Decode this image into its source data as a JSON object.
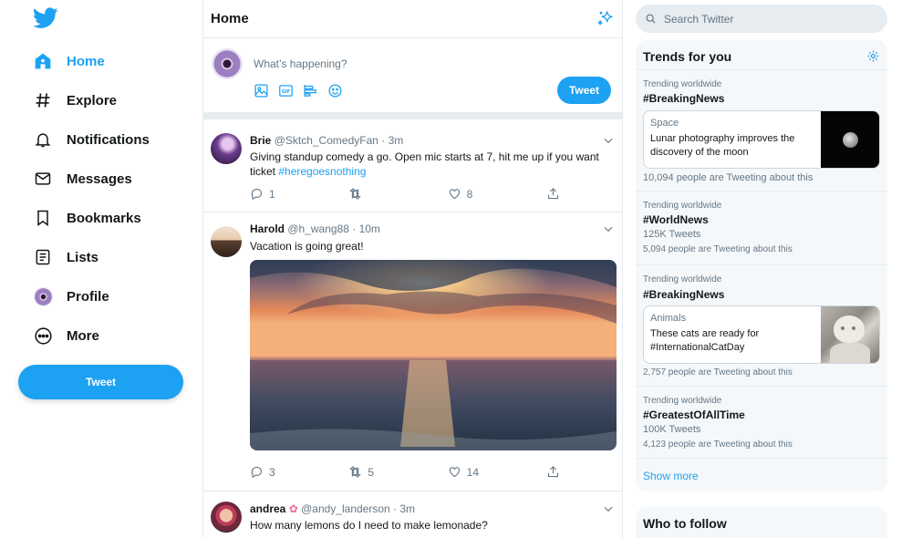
{
  "nav": {
    "items": [
      {
        "label": "Home",
        "icon": "home-icon"
      },
      {
        "label": "Explore",
        "icon": "hashtag-icon"
      },
      {
        "label": "Notifications",
        "icon": "bell-icon"
      },
      {
        "label": "Messages",
        "icon": "mail-icon"
      },
      {
        "label": "Bookmarks",
        "icon": "bookmark-icon"
      },
      {
        "label": "Lists",
        "icon": "list-icon"
      },
      {
        "label": "Profile",
        "icon": "profile-avatar-icon"
      },
      {
        "label": "More",
        "icon": "more-icon"
      }
    ],
    "tweet_button": "Tweet"
  },
  "colors": {
    "accent": "#1da1f2",
    "text": "#14171a",
    "muted": "#657786",
    "border": "#e6ecf0"
  },
  "center": {
    "title": "Home",
    "composer": {
      "placeholder": "What’s happening?",
      "tweet_button": "Tweet"
    },
    "tweets": [
      {
        "name": "Brie",
        "handle": "@Sktch_ComedyFan · 3m",
        "text": "Giving standup comedy a go. Open mic starts at 7, hit me up if you want ticket ",
        "hashtag": "#heregoesnothing",
        "replies": "1",
        "retweets": "",
        "likes": "8"
      },
      {
        "name": "Harold",
        "handle": "@h_wang88 · 10m",
        "text": "Vacation is going great!",
        "replies": "3",
        "retweets": "5",
        "likes": "14"
      },
      {
        "name": "andrea",
        "handle": "@andy_landerson · 3m",
        "text": "How many lemons do I need to make lemonade?"
      }
    ]
  },
  "right": {
    "search_placeholder": "Search Twitter",
    "trends_title": "Trends for you",
    "trends": [
      {
        "meta": "Trending worldwide",
        "tag": "#BreakingNews",
        "card": {
          "category": "Space",
          "text": "Lunar photography improves the discovery of the moon"
        },
        "count": "10,094 people are Tweeting about this"
      },
      {
        "meta": "Trending worldwide",
        "tag": "#WorldNews",
        "tweets": "125K Tweets",
        "count": "5,094 people are Tweeting about this"
      },
      {
        "meta": "Trending worldwide",
        "tag": "#BreakingNews",
        "card": {
          "category": "Animals",
          "text": "These cats are ready for #InternationalCatDay"
        },
        "count": "2,757 people are Tweeting about this"
      },
      {
        "meta": "Trending worldwide",
        "tag": "#GreatestOfAllTime",
        "tweets": "100K Tweets",
        "count": "4,123 people are Tweeting about this"
      }
    ],
    "show_more": "Show more",
    "who_to_follow": "Who to follow"
  }
}
